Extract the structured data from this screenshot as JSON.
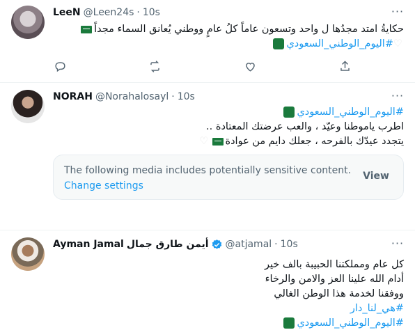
{
  "tweets": [
    {
      "name": "LeeN",
      "handle": "@Leen24s",
      "separator": "·",
      "time": "10s",
      "lines": [
        "حكايةُ امتد مجدُها ل واحد وتسعون عاماً كلُ عامٍ ووطني يُعانق السماء مجداً",
        "#اليوم_الوطني_السعودي"
      ]
    },
    {
      "name": "NORAH",
      "handle": "@Norahalosayl",
      "separator": "·",
      "time": "10s",
      "lines": [
        "#اليوم_الوطني_السعودي",
        "اطرب ياموطنا وعيّد ، والعب عرضتك المعتادة ..",
        "يتجدد عيدّك بالفرحه ، جعلك دايم من عوادة"
      ],
      "media_warning": {
        "text": "The following media includes potentially sensitive content.",
        "link": "Change settings",
        "button": "View"
      }
    },
    {
      "name": "Ayman Jamal",
      "name_ar": "أيمن طارق جمال",
      "handle": "@atjamal",
      "separator": "·",
      "time": "10s",
      "lines": [
        "كل عام ومملكتنا الحبيبة بالف خير",
        "أدام الله علينا العز والامن والرخاء",
        "ووفقنا لخدمة هذا الوطن الغالي",
        "#هي_لنا_دار",
        "#اليوم_الوطني_السعودي"
      ]
    }
  ],
  "icons": {
    "more": "more-icon",
    "reply": "reply-icon",
    "retweet": "retweet-icon",
    "like": "like-icon",
    "share": "share-icon",
    "verified": "verified-badge-icon"
  },
  "colors": {
    "accent": "#1d9bf0",
    "muted": "#536471",
    "text": "#0f1419",
    "flag": "#1a7a3c"
  }
}
